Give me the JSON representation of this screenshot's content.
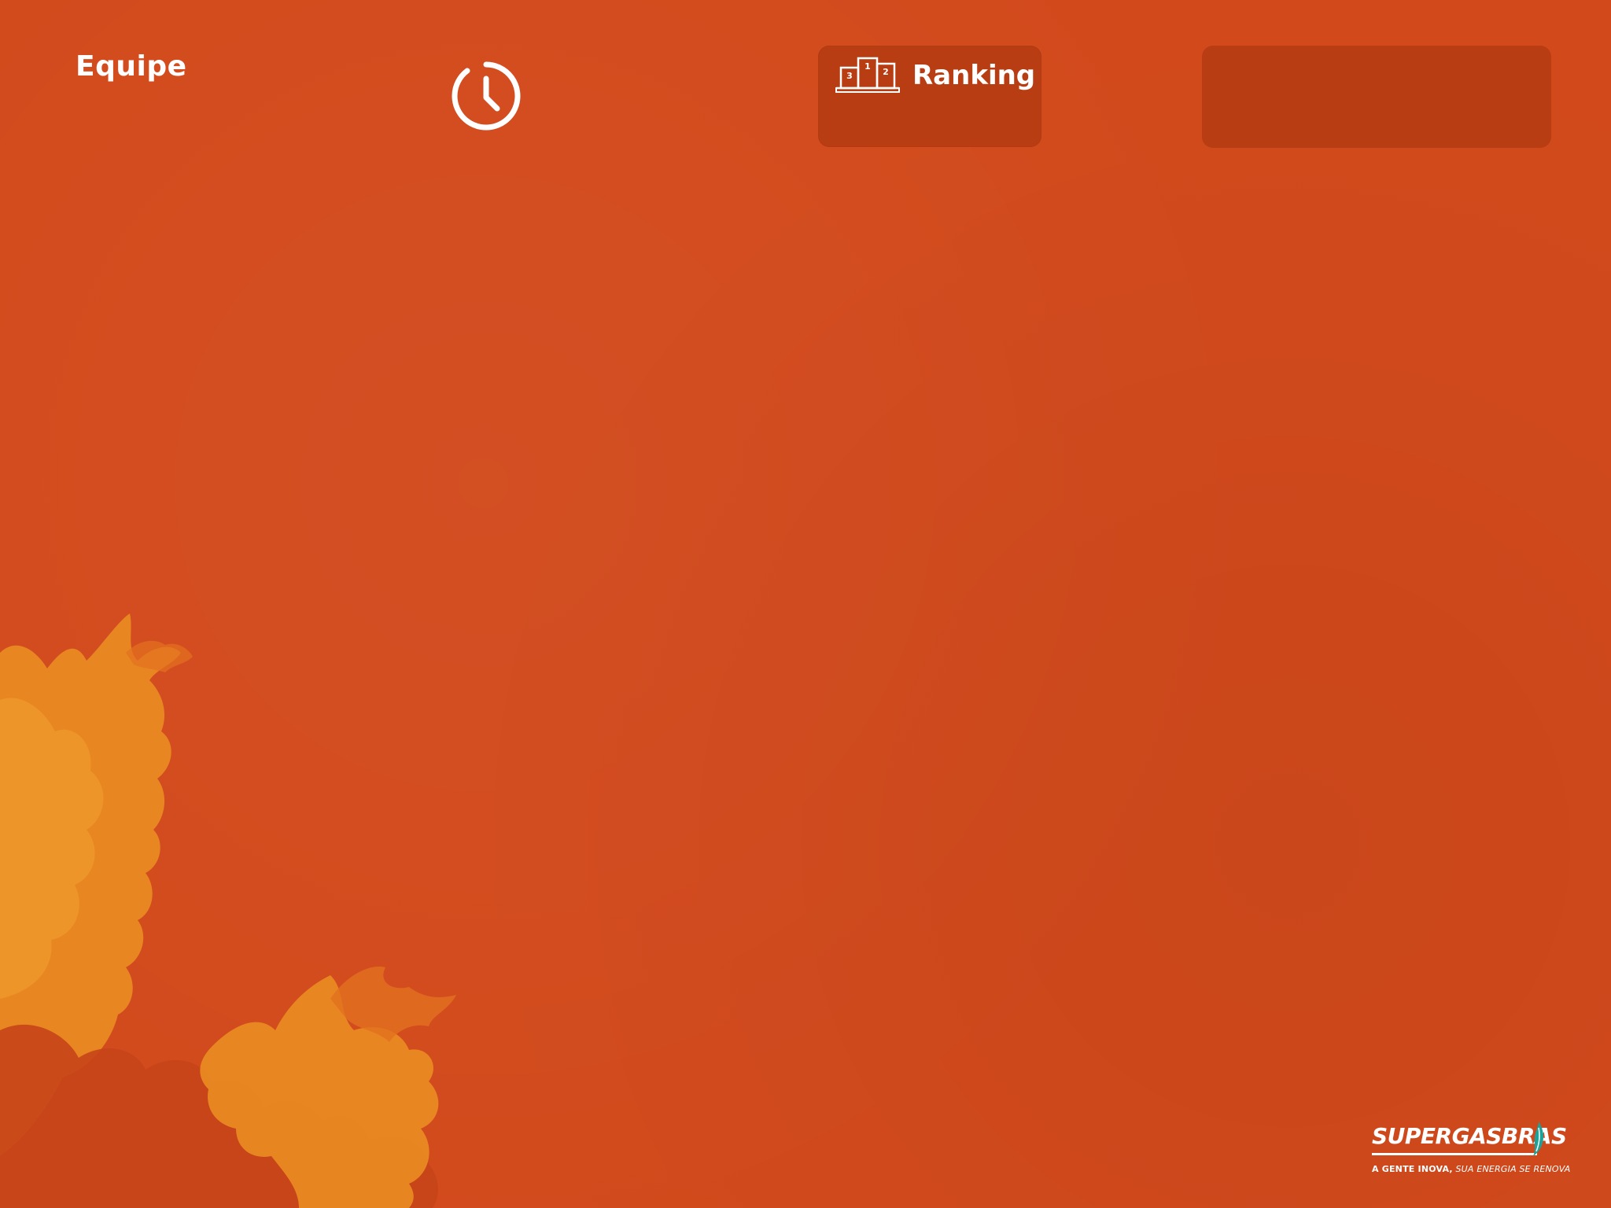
{
  "header": {
    "team_label": "Equipe",
    "ranking_label": "Ranking"
  },
  "icons": {
    "clock": "clock-icon",
    "podium": "podium-icon",
    "flame": "flame-icon"
  },
  "podium": {
    "first": "1",
    "second": "2",
    "third": "3"
  },
  "brand": {
    "name": "SUPERGASBRAS",
    "tagline_strong": "A GENTE INOVA,",
    "tagline_italic": "SUA ENERGIA SE RENOVA"
  },
  "colors": {
    "background": "#d24a1c",
    "panel": "#b83d12",
    "splash_light": "#e98a22",
    "splash_mid": "#e2701f",
    "splash_dark": "#c6441a",
    "flame_teal": "#1aa39a",
    "text": "#ffffff"
  }
}
